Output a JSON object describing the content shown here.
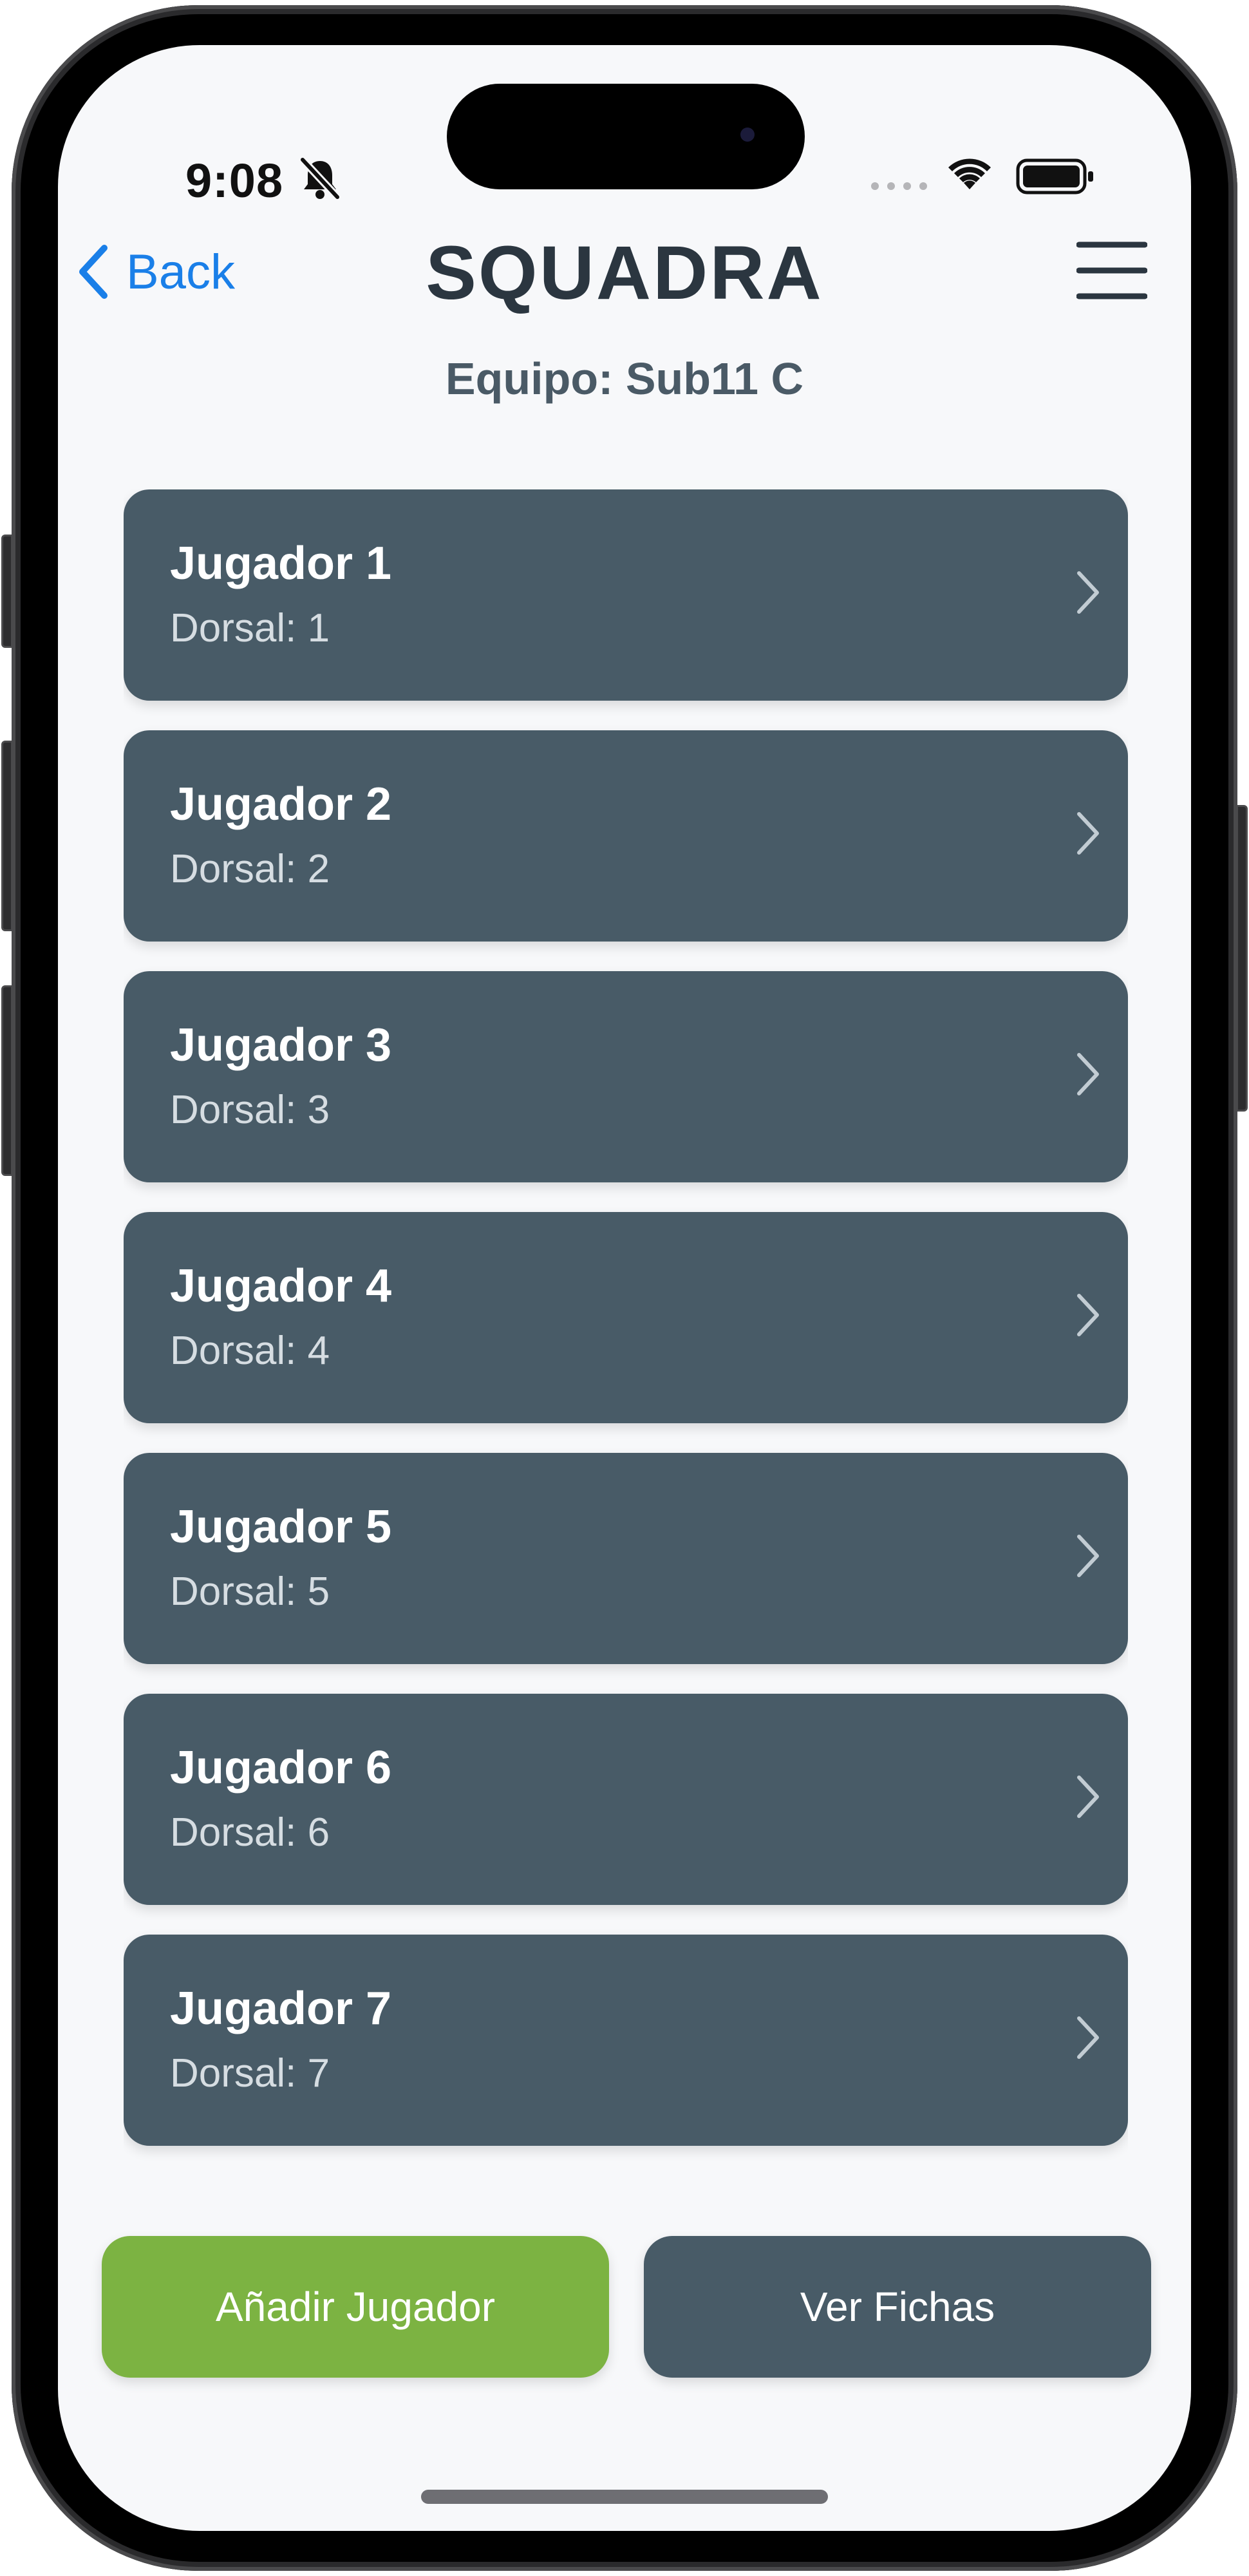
{
  "status_bar": {
    "time": "9:08",
    "icons": [
      "bell-slash-icon",
      "signal-icon",
      "wifi-icon",
      "battery-icon"
    ]
  },
  "nav": {
    "back_label": "Back",
    "title": "SQUADRA",
    "menu_icon": "hamburger-menu-icon"
  },
  "team": {
    "label": "Equipo: Sub11 C"
  },
  "players": [
    {
      "name": "Jugador 1",
      "dorsal": "Dorsal: 1"
    },
    {
      "name": "Jugador 2",
      "dorsal": "Dorsal: 2"
    },
    {
      "name": "Jugador 3",
      "dorsal": "Dorsal: 3"
    },
    {
      "name": "Jugador 4",
      "dorsal": "Dorsal: 4"
    },
    {
      "name": "Jugador 5",
      "dorsal": "Dorsal: 5"
    },
    {
      "name": "Jugador 6",
      "dorsal": "Dorsal: 6"
    },
    {
      "name": "Jugador 7",
      "dorsal": "Dorsal: 7"
    },
    {
      "name": "",
      "dorsal": ""
    }
  ],
  "actions": {
    "add_label": "Añadir Jugador",
    "fichas_label": "Ver Fichas"
  },
  "colors": {
    "accent_blue": "#1a7fe8",
    "card": "#485b67",
    "add_button": "#7cb342",
    "title": "#2b3640",
    "background": "#f7f8fa"
  }
}
